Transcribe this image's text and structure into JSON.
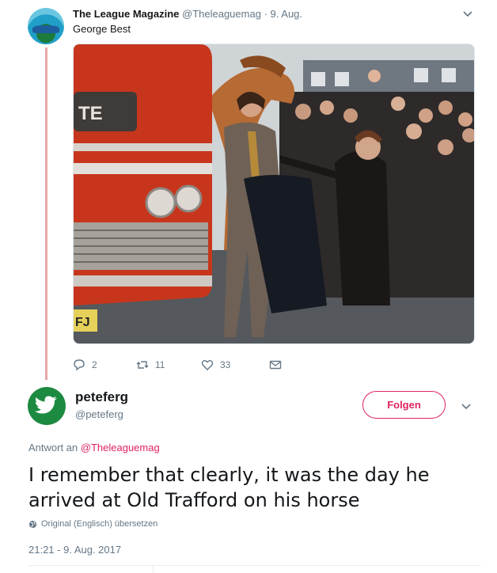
{
  "tweet1": {
    "name": "The League Magazine",
    "handle": "@Theleaguemag",
    "separator": "·",
    "date": "9. Aug.",
    "text": "George Best",
    "image_text": "TE",
    "image_plate": "FJ",
    "actions": {
      "replies": "2",
      "retweets": "11",
      "likes": "33"
    }
  },
  "tweet2": {
    "name": "peteferg",
    "handle": "@peteferg",
    "follow_label": "Folgen",
    "reply_prefix": "Antwort an",
    "reply_mention": "@Theleaguemag",
    "text": "I remember that clearly, it was the day he arrived at Old Trafford on his horse",
    "translate_label": "Original (Englisch) übersetzen",
    "timestamp": "21:21 - 9. Aug. 2017"
  },
  "colors": {
    "accent": "#e0245e",
    "muted": "#657786",
    "thread_line": "#e8a5a5"
  },
  "icons": {
    "reply": "reply-icon",
    "retweet": "retweet-icon",
    "like": "heart-icon",
    "dm": "envelope-icon",
    "caret": "chevron-down-icon",
    "globe": "globe-icon",
    "bird": "twitter-bird-icon"
  }
}
